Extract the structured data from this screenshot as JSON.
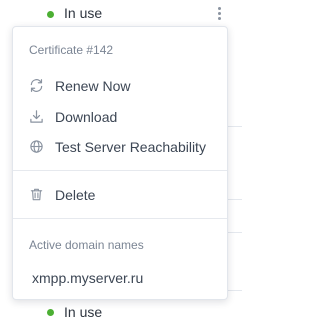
{
  "rows": {
    "top": {
      "status_label": "In use",
      "status_color": "#4caf33"
    },
    "bottom": {
      "status_label": "In use",
      "status_color": "#4caf33"
    }
  },
  "menu": {
    "header": "Certificate #142",
    "items": [
      {
        "label": "Renew Now",
        "icon": "refresh-icon"
      },
      {
        "label": "Download",
        "icon": "download-icon"
      },
      {
        "label": "Test Server Reachability",
        "icon": "globe-icon"
      },
      {
        "label": "Delete",
        "icon": "trash-icon"
      }
    ],
    "domains_section": {
      "label": "Active domain names",
      "domains": [
        "xmpp.myserver.ru"
      ]
    }
  },
  "colors": {
    "icon": "#8a93a0",
    "text": "#3c4654",
    "muted": "#7b8594",
    "status_ok": "#4caf33"
  }
}
